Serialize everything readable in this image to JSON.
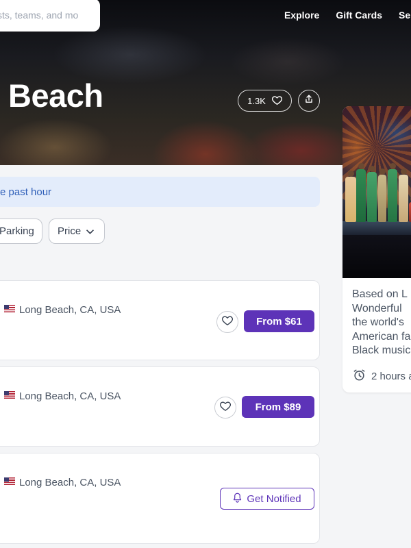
{
  "search": {
    "placeholder": "sts, teams, and mo"
  },
  "nav": {
    "items": [
      "Explore",
      "Gift Cards",
      "Se"
    ]
  },
  "hero": {
    "title": "Beach",
    "likes_count": "1.3K"
  },
  "banner": {
    "text": "e past hour"
  },
  "filters": [
    {
      "label": "Parking"
    },
    {
      "label": "Price"
    }
  ],
  "events": [
    {
      "location": "Long Beach, CA, USA",
      "action": "From $61",
      "action_type": "price",
      "favoritable": true
    },
    {
      "location": "Long Beach, CA, USA",
      "action": "From $89",
      "action_type": "price",
      "favoritable": true
    },
    {
      "location": "Long Beach, CA, USA",
      "action": "Get Notified",
      "action_type": "notify",
      "favoritable": false
    }
  ],
  "side_card": {
    "lines": [
      "Based on L",
      "Wonderful",
      "the world's",
      "American fa",
      "Black music"
    ],
    "time": "2 hours a"
  },
  "colors": {
    "accent": "#5d33b8",
    "banner_bg": "#e3ecfb",
    "banner_text": "#2f5fb8"
  },
  "icons": {
    "like": "heart-icon",
    "share": "share-icon",
    "favorite": "heart-icon",
    "notify": "bell-icon",
    "filter_dropdown": "chevron-down-icon",
    "time": "alarm-clock-icon",
    "location_flag": "us-flag-icon"
  }
}
